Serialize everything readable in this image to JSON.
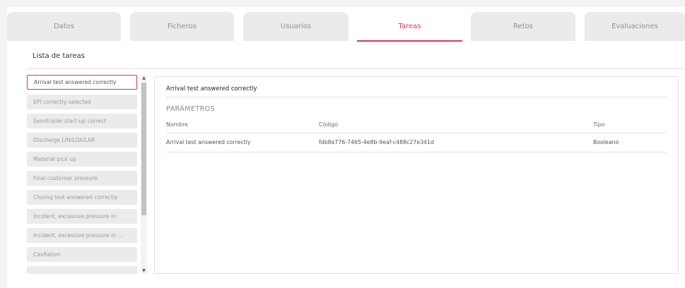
{
  "tabs": [
    {
      "label": "Datos"
    },
    {
      "label": "Ficheros"
    },
    {
      "label": "Usuarios"
    },
    {
      "label": "Tareas"
    },
    {
      "label": "Retos"
    },
    {
      "label": "Evaluaciones"
    }
  ],
  "active_tab": "Tareas",
  "section": {
    "title": "Lista de tareas"
  },
  "tasks": [
    "Arrival test answered correctly",
    "EPI correctly selected",
    "Semitrailer start-up correct",
    "Discharge LIN/LOX/LAR",
    "Material pick up",
    "Final customer pressure",
    "Closing test answered correctly",
    "Incident, excessive pressure in",
    "Incident, excessive pressure in ...",
    "Cavitation",
    ""
  ],
  "selected_task": "Arrival test answered correctly",
  "detail": {
    "title": "Arrival test answered correctly",
    "params_label": "PARÁMETROS",
    "columns": {
      "name": "Nombre",
      "code": "Código",
      "type": "Tipo"
    },
    "rows": [
      {
        "name": "Arrival test answered correctly",
        "code": "fdb8e776-7465-4e8b-9eaf-c488c27e341d",
        "type": "Booleano"
      }
    ]
  },
  "colors": {
    "accent": "#e0306e",
    "tab_bg": "#ebebed",
    "page_bg": "#f3f3f5"
  }
}
